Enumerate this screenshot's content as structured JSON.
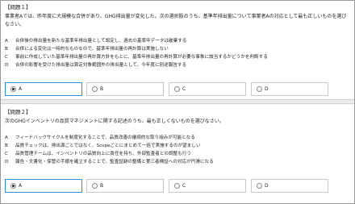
{
  "q1": {
    "title": "【問題１】",
    "text": "事業者Aでは、昨年度に大規模な合併があり、GHG排出量が変化した。次の選択肢のうち、基準年排出量について事業者Aの対応として最も正しいものを選びなさい。",
    "choices": [
      {
        "letter": "A",
        "text": "合併後の排出量を新たな基準年排出量として設定し、過去の基準年データは破棄する"
      },
      {
        "letter": "B",
        "text": "合併による変化は一時的なものなので、基準年排出量の再計算は実施しない"
      },
      {
        "letter": "C",
        "text": "事前に作成していた基準年排出量の再計算方針をもとに、基準年排出量の再計算が必要な事象に該当するかどうかを判断する"
      },
      {
        "letter": "D",
        "text": "合併の影響を受けた排出量は算定対象範囲外の排出量として、今年度に別途報告する"
      }
    ],
    "answers": [
      "A",
      "B",
      "C",
      "D"
    ],
    "selected": "A"
  },
  "q2": {
    "title": "【問題２】",
    "text": "次のGHGインベントリの品質マネジメントに関する記述のうち、最も正しくないものを選びなさい。",
    "choices": [
      {
        "letter": "A",
        "text": "フィードバックサイクルを制度化することで、品質改善の継続的な取り組みが可能となる"
      },
      {
        "letter": "B",
        "text": "品質チェックは、排出源ごとではなく、Scopeごとにまとめて一括で実施するのが望ましい"
      },
      {
        "letter": "C",
        "text": "品質管理チームは、インベントリの品質向上に責任を持ち、外部監査者との調整も行う"
      },
      {
        "letter": "D",
        "text": "報告・文書化・保管の手順を確立することで、監査証跡の整備と第三者検証への対応が円滑になる"
      }
    ],
    "answers": [
      "A",
      "B",
      "C",
      "D"
    ],
    "selected": "A"
  }
}
